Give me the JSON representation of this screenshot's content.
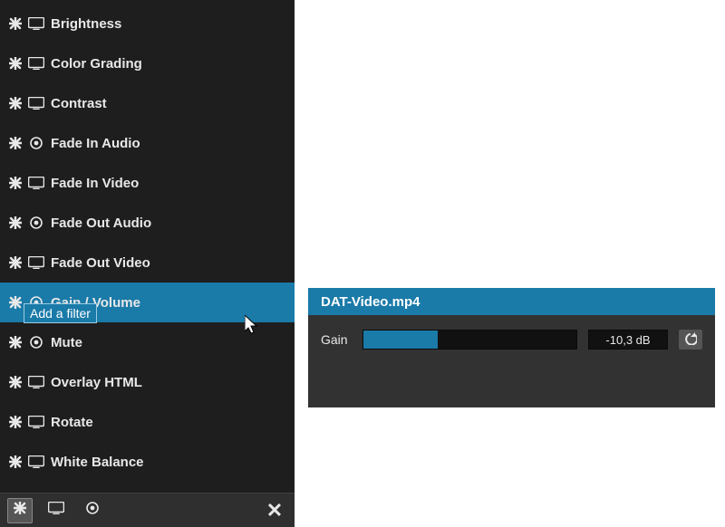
{
  "filters": [
    {
      "label": "Brightness",
      "type": "video",
      "selected": false
    },
    {
      "label": "Color Grading",
      "type": "video",
      "selected": false
    },
    {
      "label": "Contrast",
      "type": "video",
      "selected": false
    },
    {
      "label": "Fade In Audio",
      "type": "audio",
      "selected": false
    },
    {
      "label": "Fade In Video",
      "type": "video",
      "selected": false
    },
    {
      "label": "Fade Out Audio",
      "type": "audio",
      "selected": false
    },
    {
      "label": "Fade Out Video",
      "type": "video",
      "selected": false
    },
    {
      "label": "Gain / Volume",
      "type": "audio",
      "selected": true
    },
    {
      "label": "Mute",
      "type": "audio",
      "selected": false
    },
    {
      "label": "Overlay HTML",
      "type": "video",
      "selected": false
    },
    {
      "label": "Rotate",
      "type": "video",
      "selected": false
    },
    {
      "label": "White Balance",
      "type": "video",
      "selected": false
    }
  ],
  "tooltip": "Add a filter",
  "props": {
    "title": "DAT-Video.mp4",
    "gain_label": "Gain",
    "gain_value": "-10,3 dB",
    "gain_fill_pct": 35
  }
}
